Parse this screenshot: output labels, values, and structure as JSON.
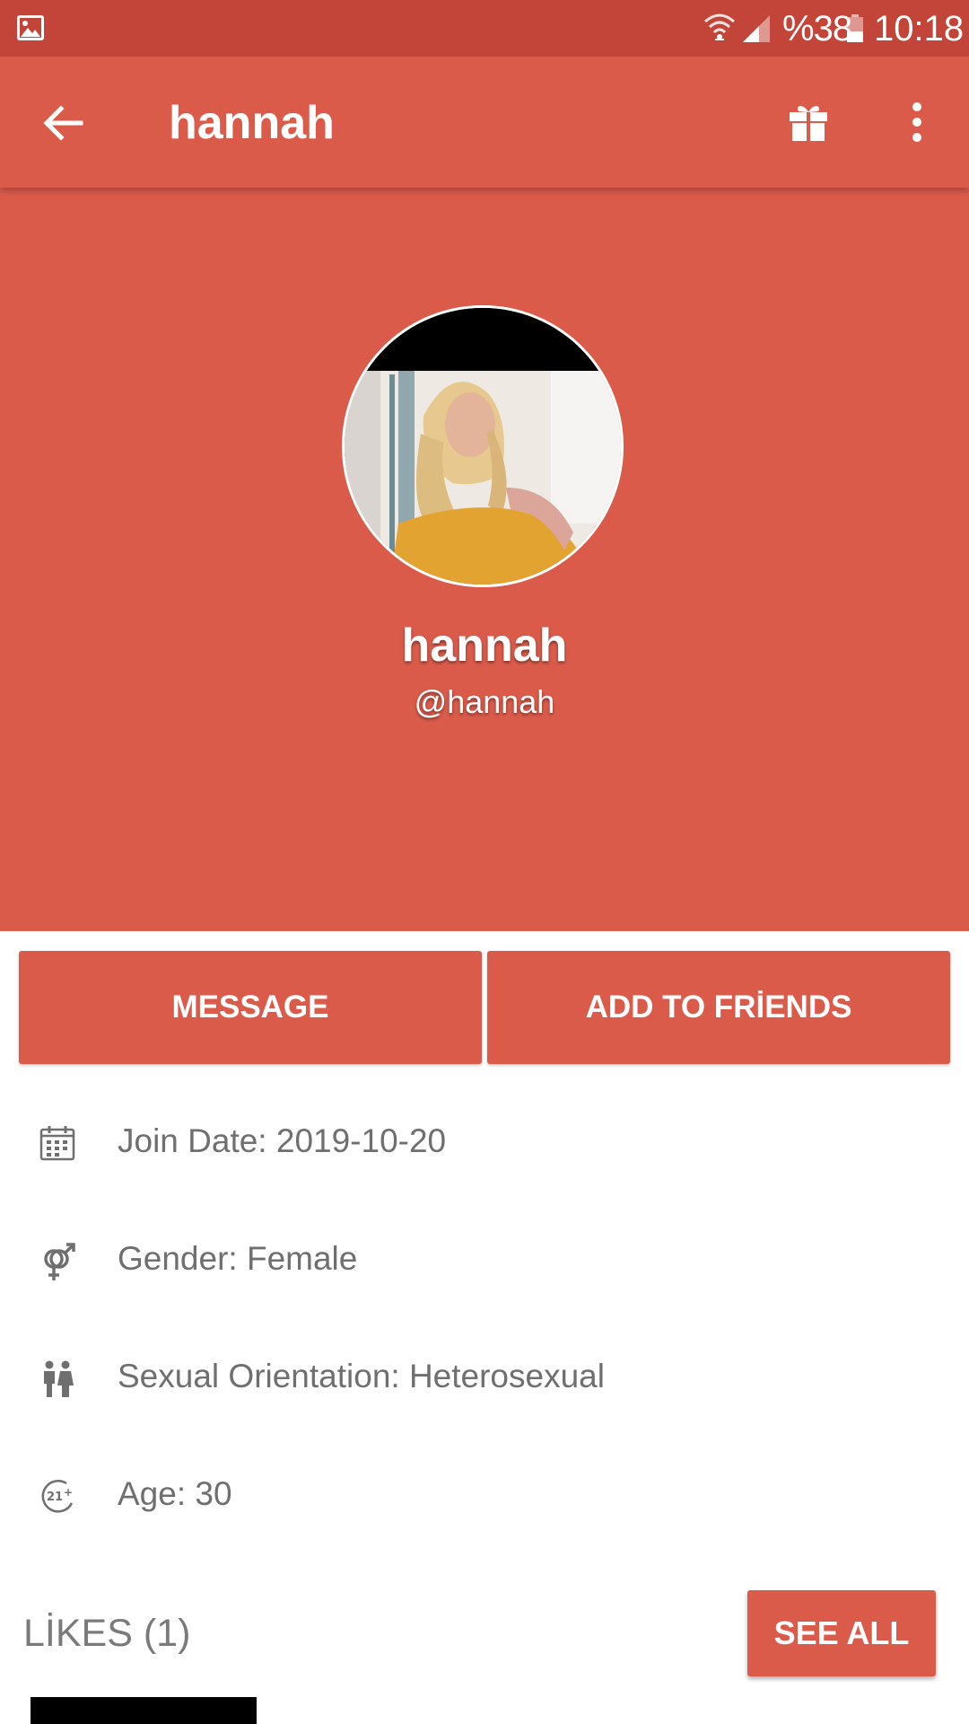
{
  "status_bar": {
    "battery": "%38",
    "time": "10:18"
  },
  "app_bar": {
    "title": "hannah"
  },
  "profile": {
    "name": "hannah",
    "handle": "@hannah"
  },
  "actions": {
    "message_label": "MESSAGE",
    "add_friends_label": "ADD TO FRİENDS"
  },
  "info": {
    "join_date": "Join Date: 2019-10-20",
    "gender": "Gender: Female",
    "orientation": "Sexual Orientation: Heterosexual",
    "age": "Age: 30"
  },
  "likes": {
    "title": "LİKES (1)",
    "see_all_label": "SEE ALL"
  },
  "colors": {
    "accent": "#db5b4b",
    "status_bar": "#c34438",
    "text_secondary": "#6f6f6f"
  },
  "icons": {
    "status": [
      "gallery-icon",
      "wifi-icon",
      "signal-icon",
      "battery-icon"
    ],
    "app_bar": [
      "back-arrow-icon",
      "gift-icon",
      "more-vert-icon"
    ],
    "info": [
      "calendar-icon",
      "gender-icon",
      "couple-icon",
      "age-21-plus-icon"
    ]
  }
}
